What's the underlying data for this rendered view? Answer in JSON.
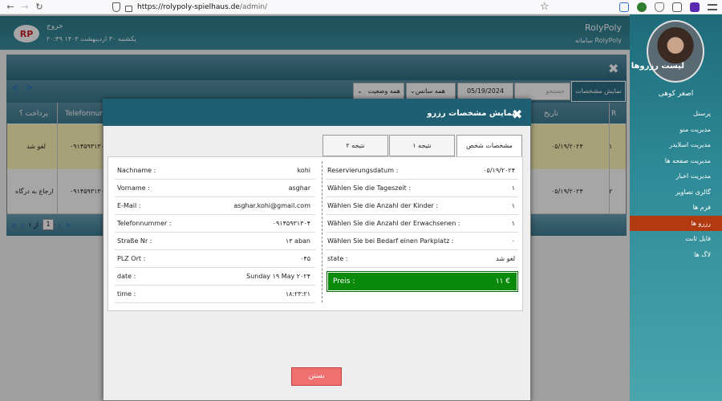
{
  "browser": {
    "url_host": "https://rolypoly-spielhaus.de",
    "url_path": "/admin/"
  },
  "header": {
    "logout": "خروج",
    "date": "یکشنبه ۳۰ اردیبهشت ۱۴۰۳ ۲۰:۴۹",
    "brand": "RolyPoly",
    "brand_sub": "سامانه RolyPoly"
  },
  "sidebar": {
    "username": "اصغر کوهی",
    "items": [
      {
        "label": "پرسنل"
      },
      {
        "label": "مدیریت منو"
      },
      {
        "label": "مدیریت اسلایدر"
      },
      {
        "label": "مدیریت صفحه ها"
      },
      {
        "label": "مدیریت اخبار"
      },
      {
        "label": "گالری تصاویر"
      },
      {
        "label": "فرم ها"
      },
      {
        "label": "رزرو ها"
      },
      {
        "label": "فایل ثابت"
      },
      {
        "label": "لاگ ها"
      }
    ]
  },
  "panel": {
    "title": "لیست رزروها",
    "show_button": "نمایش مشخصات",
    "search_placeholder": "جستجو",
    "date_value": "05/19/2024",
    "session_select": "همه سانس ها",
    "status_select": "همه وضعیت",
    "columns": {
      "r": "R",
      "date": "تاریخ",
      "phone": "Telefonnummer",
      "paid": "پرداخت ؟"
    },
    "rows": [
      {
        "r": "۱",
        "date": "۰۵/۱۹/۲۰۲۴",
        "phone": "۰۹۱۴۵۹۳۱۳۰۴",
        "paid": "لغو شد"
      },
      {
        "r": "۲",
        "date": "۰۵/۱۹/۲۰۲۴",
        "phone": "۰۹۱۴۵۹۳۱۳۰۴",
        "paid": "ارجاع به درگاه"
      }
    ],
    "pager": {
      "page": "1",
      "of": "از ۱"
    }
  },
  "dialog": {
    "title": "نمایش مشخصات رزرو",
    "tabs": [
      "مشخصات شخص",
      "نتیجه ۱",
      "نتیجه ۲"
    ],
    "left": [
      {
        "k": "Nachname :",
        "v": "kohi"
      },
      {
        "k": "Vorname :",
        "v": "asghar"
      },
      {
        "k": "E-Mail :",
        "v": "asghar.kohi@gmail.com"
      },
      {
        "k": "Telefonnummer :",
        "v": "۰۹۱۴۵۹۳۱۳۰۴"
      },
      {
        "k": "Straße Nr :",
        "v": "۱۳ aban"
      },
      {
        "k": "PLZ Ort :",
        "v": "۰۴۵"
      },
      {
        "k": "date :",
        "v": "Sunday ۱۹ May ۲۰۲۴"
      },
      {
        "k": "time :",
        "v": "۱۸:۲۳:۲۱"
      }
    ],
    "right": [
      {
        "k": "Reservierungsdatum :",
        "v": "۰۵/۱۹/۲۰۲۴"
      },
      {
        "k": "Wählen Sie die Tageszeit :",
        "v": "۱"
      },
      {
        "k": "Wählen Sie die Anzahl der Kinder :",
        "v": "۱"
      },
      {
        "k": "Wählen Sie die Anzahl der Erwachsenen :",
        "v": "۱"
      },
      {
        "k": "Wählen Sie bei Bedarf einen Parkplatz :",
        "v": "۰"
      },
      {
        "k": "state :",
        "v": "لغو شد"
      }
    ],
    "price": {
      "k": "Preis :",
      "v": "۱۱ €"
    },
    "close_button": "بستن"
  }
}
